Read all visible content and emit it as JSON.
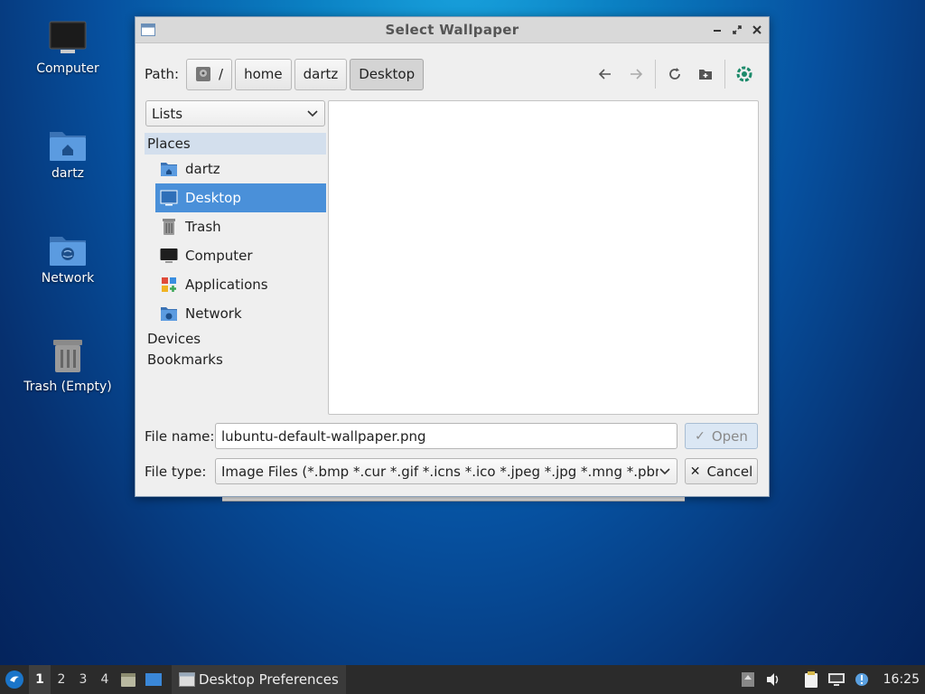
{
  "desktop": {
    "icons": [
      {
        "label": "Computer"
      },
      {
        "label": "dartz"
      },
      {
        "label": "Network"
      },
      {
        "label": "Trash (Empty)"
      }
    ]
  },
  "dialog": {
    "title": "Select Wallpaper",
    "path_label": "Path:",
    "breadcrumbs": [
      "/",
      "home",
      "dartz",
      "Desktop"
    ],
    "view_select": "Lists",
    "places_header": "Places",
    "places": [
      {
        "label": "dartz",
        "icon": "home-folder-icon"
      },
      {
        "label": "Desktop",
        "icon": "desktop-icon",
        "selected": true
      },
      {
        "label": "Trash",
        "icon": "trash-icon"
      },
      {
        "label": "Computer",
        "icon": "computer-icon"
      },
      {
        "label": "Applications",
        "icon": "applications-icon"
      },
      {
        "label": "Network",
        "icon": "network-icon"
      }
    ],
    "devices_label": "Devices",
    "bookmarks_label": "Bookmarks",
    "file_name_label": "File name:",
    "file_name_value": "lubuntu-default-wallpaper.png",
    "file_type_label": "File type:",
    "file_type_value": "Image Files (*.bmp *.cur *.gif *.icns *.ico *.jpeg *.jpg *.mng *.pbm *.pgm",
    "open_label": "Open",
    "cancel_label": "Cancel"
  },
  "taskbar": {
    "workspaces": [
      "1",
      "2",
      "3",
      "4"
    ],
    "task_label": "Desktop Preferences",
    "clock": "16:25"
  },
  "colors": {
    "selection": "#4a90d9",
    "taskbar": "#2b2b2b",
    "folder_blue": "#4a86c8"
  }
}
